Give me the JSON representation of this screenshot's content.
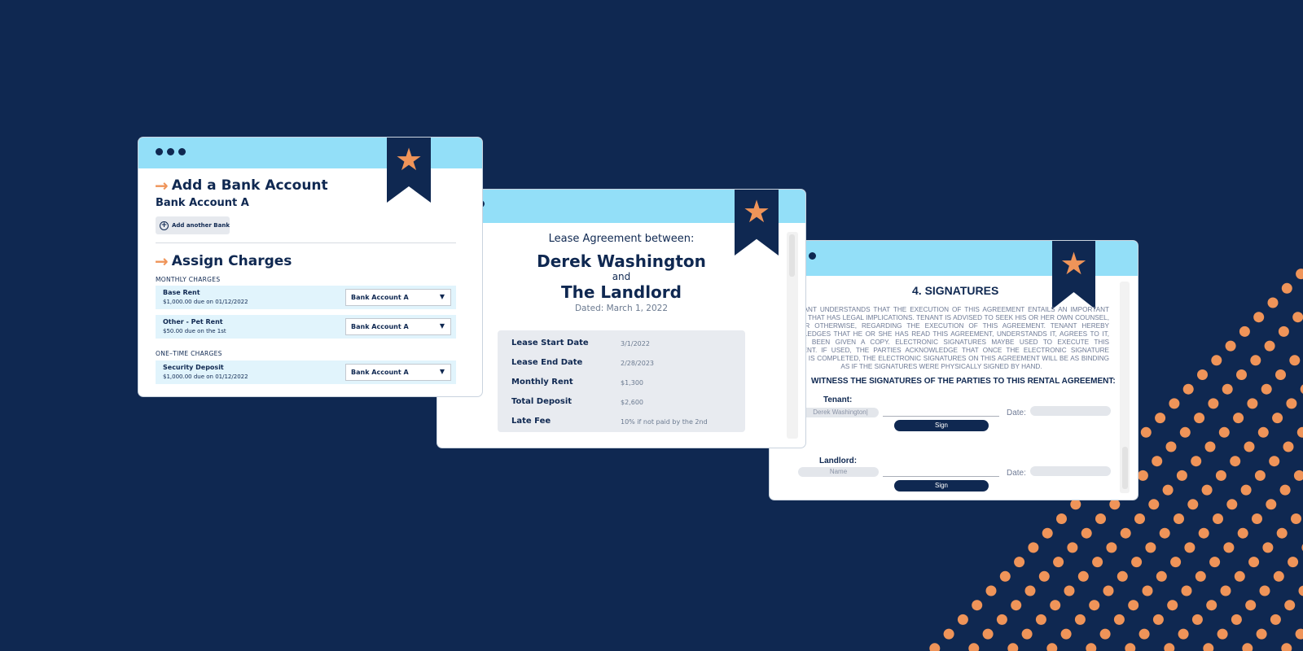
{
  "colors": {
    "background": "#0f2851",
    "header": "#93dff8",
    "accent": "#ef9459",
    "row": "#e1f4fc"
  },
  "bank_window": {
    "section1_title": "Add a Bank Account",
    "account_name": "Bank Account A",
    "add_bank_label": "Add another Bank",
    "section2_title": "Assign Charges",
    "monthly_label": "MONTHLY CHARGES",
    "onetime_label": "ONE–TIME CHARGES",
    "charges": [
      {
        "title": "Base Rent",
        "detail": "$1,000.00 due on 01/12/2022",
        "account": "Bank Account A"
      },
      {
        "title": "Other - Pet Rent",
        "detail": "$50.00 due on the 1st",
        "account": "Bank Account A"
      },
      {
        "title": "Security Deposit",
        "detail": "$1,000.00 due on 01/12/2022",
        "account": "Bank Account A"
      }
    ]
  },
  "lease_window": {
    "intro": "Lease Agreement between:",
    "party1": "Derek Washington",
    "and": "and",
    "party2": "The Landlord",
    "dated": "Dated: March 1, 2022",
    "rows": [
      {
        "label": "Lease Start Date",
        "value": "3/1/2022"
      },
      {
        "label": "Lease End Date",
        "value": "2/28/2023"
      },
      {
        "label": "Monthly Rent",
        "value": "$1,300"
      },
      {
        "label": "Total Deposit",
        "value": "$2,600"
      },
      {
        "label": "Late Fee",
        "value": "10% if not paid by the 2nd"
      }
    ]
  },
  "signature_window": {
    "title": "4. SIGNATURES",
    "paragraph": "THE TENANT UNDERSTANDS THAT THE EXECUTION OF THIS AGREEMENT ENTAILS AN IMPORTANT DECISION THAT HAS LEGAL IMPLICATIONS. TENANT IS ADVISED TO SEEK HIS OR HER OWN COUNSEL, LEGAL OR OTHERWISE, REGARDING THE EXECUTION OF THIS AGREEMENT. TENANT HEREBY ACKNOWLEDGES THAT HE OR SHE HAS READ THIS AGREEMENT, UNDERSTANDS IT, AGREES TO IT, AND HAS BEEN GIVEN A COPY. ELECTRONIC SIGNATURES MAYBE USED TO EXECUTE THIS AGREEMENT. IF USED, THE PARTIES ACKNOWLEDGE THAT ONCE THE ELECTRONIC SIGNATURE PROCESS IS COMPLETED, THE ELECTRONIC SIGNATURES ON THIS AGREEMENT WILL BE AS BINDING AS IF THE SIGNATURES WERE PHYSICALLY SIGNED BY HAND.",
    "witness": "WITNESS THE SIGNATURES OF THE PARTIES TO THIS RENTAL AGREEMENT:",
    "tenant_label": "Tenant:",
    "tenant_name": "Derek Washington|",
    "landlord_label": "Landlord:",
    "landlord_placeholder": "Name",
    "date_label": "Date:",
    "sign_label": "Sign"
  }
}
